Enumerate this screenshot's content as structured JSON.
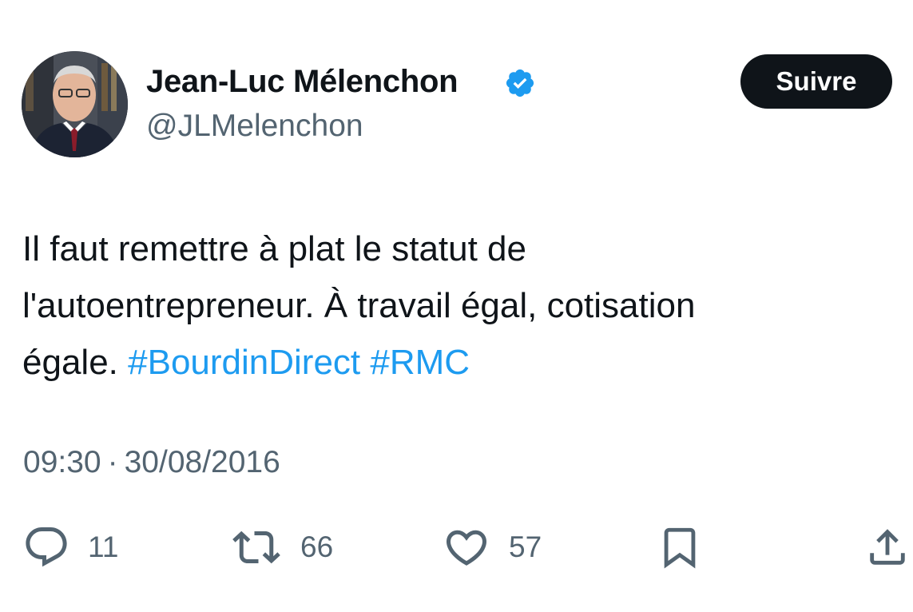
{
  "tweet": {
    "author": {
      "display_name": "Jean-Luc Mélenchon",
      "handle": "@JLMelenchon",
      "verified": true
    },
    "follow_label": "Suivre",
    "text": {
      "line1": "Il faut remettre à plat le statut de",
      "line2": "l'autoentrepreneur. À travail égal, cotisation",
      "line3_prefix": "égale.",
      "hashtags": [
        "#BourdinDirect",
        "#RMC"
      ]
    },
    "time": "09:30",
    "separator": "·",
    "date": "30/08/2016",
    "actions": {
      "replies": "11",
      "retweets": "66",
      "likes": "57"
    }
  },
  "colors": {
    "text": "#0f1419",
    "secondary": "#536471",
    "link": "#1d9bf0",
    "verified_badge": "#1d9bf0",
    "follow_button": "#0f1419"
  },
  "icons": {
    "verified": "verified-badge-icon",
    "reply": "speech-bubble-icon",
    "retweet": "retweet-arrows-icon",
    "like": "heart-icon",
    "bookmark": "bookmark-icon",
    "share": "share-upload-icon"
  }
}
